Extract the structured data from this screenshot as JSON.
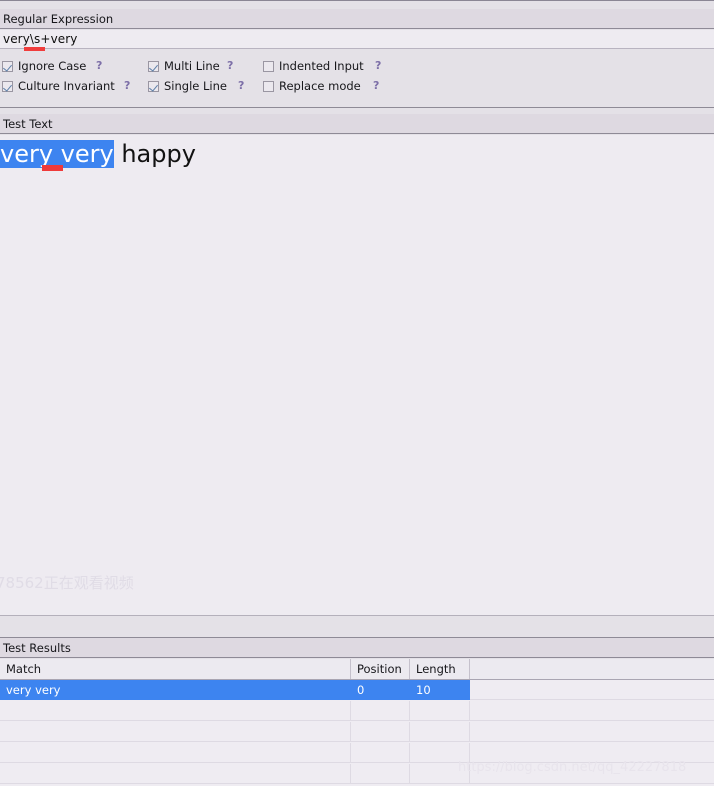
{
  "regex_section": {
    "header_label": "Regular Expression",
    "pattern_value": "very\\s+very",
    "options": [
      {
        "label": "Ignore Case",
        "checked": true,
        "help": "?"
      },
      {
        "label": "Culture Invariant",
        "checked": true,
        "help": "?"
      },
      {
        "label": "Multi Line",
        "checked": true,
        "help": "?"
      },
      {
        "label": "Single Line",
        "checked": true,
        "help": "?"
      },
      {
        "label": "Indented Input",
        "checked": false,
        "help": "?"
      },
      {
        "label": "Replace mode",
        "checked": false,
        "help": "?"
      }
    ]
  },
  "test_text_section": {
    "header_label": "Test Text",
    "matched_text": "very very",
    "trailing_text": " happy",
    "watermark": "78562正在观看视频"
  },
  "test_results_section": {
    "header_label": "Test Results",
    "columns": [
      "Match",
      "Position",
      "Length"
    ],
    "rows": [
      {
        "match": "very  very",
        "position": "0",
        "length": "10",
        "selected": true
      }
    ],
    "watermark": "https://blog.csdn.net/qq_42227818"
  },
  "colors": {
    "window_background": "#e4e1e7",
    "field_background": "#eeebf1",
    "selection_blue": "#3d84f0",
    "error_red": "#f03c3c",
    "help_purple": "#7d6fa8"
  }
}
